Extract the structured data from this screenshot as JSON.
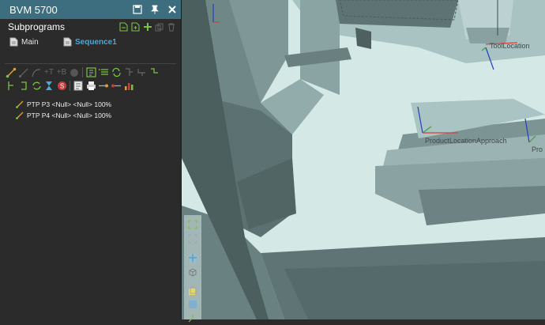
{
  "panel": {
    "title": "BVM 5700",
    "pin_icon": "pin-icon",
    "close_icon": "close-icon",
    "subprograms_label": "Subprograms",
    "programs": [
      {
        "name": "Main"
      },
      {
        "name": "Sequence1"
      }
    ],
    "commands": [
      {
        "text": "PTP P3 <Null> <Null> 100%"
      },
      {
        "text": "PTP P4 <Null> <Null> 100%"
      }
    ]
  },
  "viewport": {
    "labels": {
      "tool_location": "ToolLocation",
      "product_location_approach": "ProductLocationApproach",
      "pro_partial": "Pro"
    }
  },
  "colors": {
    "titlebar": "#3c6e80",
    "panel_bg": "#2b2b2b",
    "accent_green": "#7bc142",
    "accent_orange": "#e0a030",
    "sequence_blue": "#4aa8d8",
    "scene_bg": "#cfe5e3"
  }
}
